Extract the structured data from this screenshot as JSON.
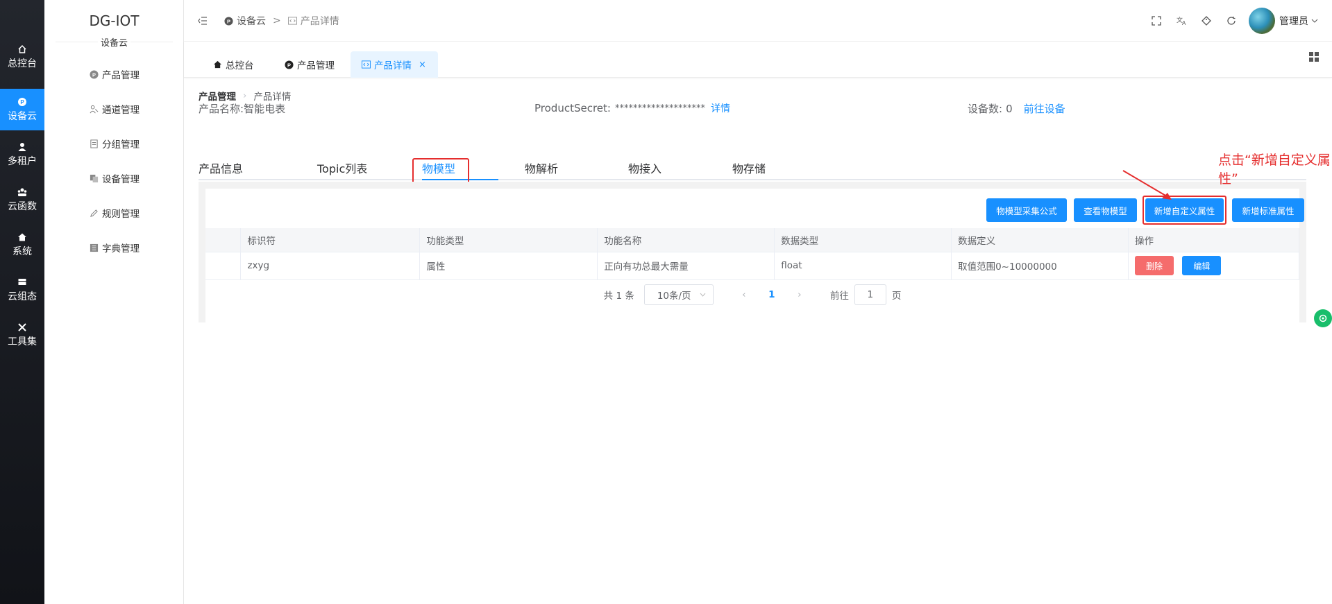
{
  "brand": {
    "title": "DG-IOT",
    "subtitle": "设备云"
  },
  "sidebar": {
    "items": [
      {
        "label": "总控台",
        "icon": "home-icon"
      },
      {
        "label": "设备云",
        "icon": "p-badge-icon",
        "active": true
      },
      {
        "label": "多租户",
        "icon": "user-icon"
      },
      {
        "label": "云函数",
        "icon": "group-icon"
      },
      {
        "label": "系统",
        "icon": "house-icon"
      },
      {
        "label": "云组态",
        "icon": "monitor-icon"
      },
      {
        "label": "工具集",
        "icon": "tools-icon"
      }
    ]
  },
  "submenu": {
    "items": [
      {
        "label": "产品管理",
        "icon": "p-badge-icon"
      },
      {
        "label": "通道管理",
        "icon": "channel-icon"
      },
      {
        "label": "分组管理",
        "icon": "document-icon"
      },
      {
        "label": "设备管理",
        "icon": "copy-icon"
      },
      {
        "label": "规则管理",
        "icon": "pencil-icon"
      },
      {
        "label": "字典管理",
        "icon": "dictionary-icon"
      }
    ]
  },
  "topbar": {
    "crumbs": [
      {
        "label": "设备云",
        "icon": "p-badge-icon"
      },
      {
        "label": "产品详情",
        "icon": "code-icon"
      }
    ],
    "user": "管理员",
    "icons": [
      "fullscreen-icon",
      "translate-icon",
      "tag-icon",
      "refresh-icon"
    ]
  },
  "view_tabs": [
    {
      "label": "总控台",
      "icon": "home-icon"
    },
    {
      "label": "产品管理",
      "icon": "p-badge-icon"
    },
    {
      "label": "产品详情",
      "icon": "code-icon",
      "active": true,
      "close": "×"
    }
  ],
  "page": {
    "breadcrumb": {
      "parent": "产品管理",
      "current": "产品详情"
    },
    "product_name_label": "产品名称:",
    "product_name": "智能电表",
    "secret_label": "ProductSecret:",
    "secret_value": "********************",
    "secret_link": "详情",
    "device_count_label": "设备数:",
    "device_count": "0",
    "device_link": "前往设备"
  },
  "product_tabs": [
    {
      "label": "产品信息"
    },
    {
      "label": "Topic列表"
    },
    {
      "label": "物模型",
      "active": true
    },
    {
      "label": "物解析"
    },
    {
      "label": "物接入"
    },
    {
      "label": "物存储"
    }
  ],
  "toolbar": {
    "btn_formula": "物模型采集公式",
    "btn_view": "查看物模型",
    "btn_add_custom": "新增自定义属性",
    "btn_add_standard": "新增标准属性"
  },
  "table": {
    "headers": [
      "",
      "标识符",
      "功能类型",
      "功能名称",
      "数据类型",
      "数据定义",
      "操作"
    ],
    "rows": [
      {
        "identifier": "zxyg",
        "func_type": "属性",
        "func_name": "正向有功总最大需量",
        "data_type": "float",
        "data_def": "取值范围0~10000000"
      }
    ],
    "delete_label": "删除",
    "edit_label": "编辑"
  },
  "pagination": {
    "total": "共 1 条",
    "page_size": "10条/页",
    "current_page": "1",
    "goto_label": "前往",
    "goto_value": "1",
    "page_unit": "页"
  },
  "annotation": {
    "text": "点击“新增自定义属性”",
    "color": "#e52e2e"
  },
  "colors": {
    "accent": "#1890ff",
    "danger": "#f56c6c",
    "highlight": "#e52e2e",
    "sidebar_bg": "#1c1f25"
  }
}
